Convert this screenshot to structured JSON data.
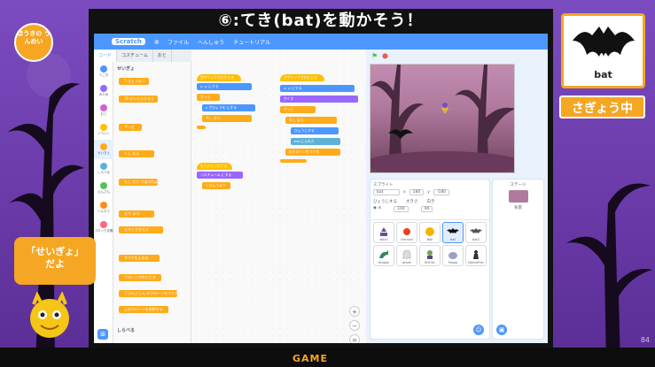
{
  "slide": {
    "title": "⑥:てき(bat)を動かそう！",
    "logo_text": "ほうきの うんめい",
    "page_number": "84",
    "footer_logo": "GAME",
    "sprite_card_label": "bat",
    "status_badge": "さぎょう中",
    "bubble_line1": "「せいぎょ」",
    "bubble_line2": "だよ"
  },
  "scratch": {
    "menu": {
      "logo": "Scratch",
      "file": "ファイル",
      "edit": "へんしゅう",
      "tutorial": "チュートリアル"
    },
    "tabs": [
      "コード",
      "コスチューム",
      "おと"
    ],
    "categories": [
      {
        "label": "うごき",
        "color": "#4c97ff"
      },
      {
        "label": "みため",
        "color": "#9966ff"
      },
      {
        "label": "おと",
        "color": "#cf63cf"
      },
      {
        "label": "イベント",
        "color": "#ffbf00"
      },
      {
        "label": "せいぎょ",
        "color": "#ffab19"
      },
      {
        "label": "しらべる",
        "color": "#5cb1d6"
      },
      {
        "label": "えんざん",
        "color": "#59c059"
      },
      {
        "label": "へんすう",
        "color": "#ff8c1a"
      },
      {
        "label": "ブロック定義",
        "color": "#ff6680"
      }
    ],
    "palette_title": "せいぎょ",
    "palette_title_2": "しらべる",
    "palette_blocks": [
      "1 びょうまつ",
      "10 かいくりかえす",
      "ずっと",
      "もし なら",
      "もし なら でなければ",
      "まで まつ",
      "までくりかえす",
      "すべてを止める",
      "クローンされたとき",
      "じぶんじしん のクローンをつくる",
      "このクローンを削除する"
    ],
    "scripts_a": [
      "がクリックされたとき",
      "x: y: にする",
      "ずっと",
      "y ざひょうを にする",
      "もし なら"
    ],
    "scripts_b": [
      "をうけとったとき",
      "コスチューム にする",
      "1 びょうまつ"
    ],
    "scripts_c": [
      "がクリックされたとき",
      "x: y: にする",
      "かくす",
      "ずっと",
      "もし なら",
      "ひょうじする",
      "bat にふれた",
      "のクローンをつくる"
    ],
    "sprite_panel": {
      "sprite_label": "スプライト",
      "sprite_name": "bat",
      "x_label": "x",
      "x_value": "180",
      "y_label": "y",
      "y_value": "-180",
      "show_label": "ひょうじする",
      "size_label": "大きさ",
      "size_value": "100",
      "direction_label": "向き",
      "direction_value": "90"
    },
    "sprites": [
      "witch",
      "fire ball",
      "Ball",
      "bat",
      "bat2",
      "dragon",
      "ghost",
      "GHOUL",
      "Hippo",
      "DanceFrer"
    ],
    "stage_label": "ステージ",
    "backdrops_label": "背景"
  }
}
